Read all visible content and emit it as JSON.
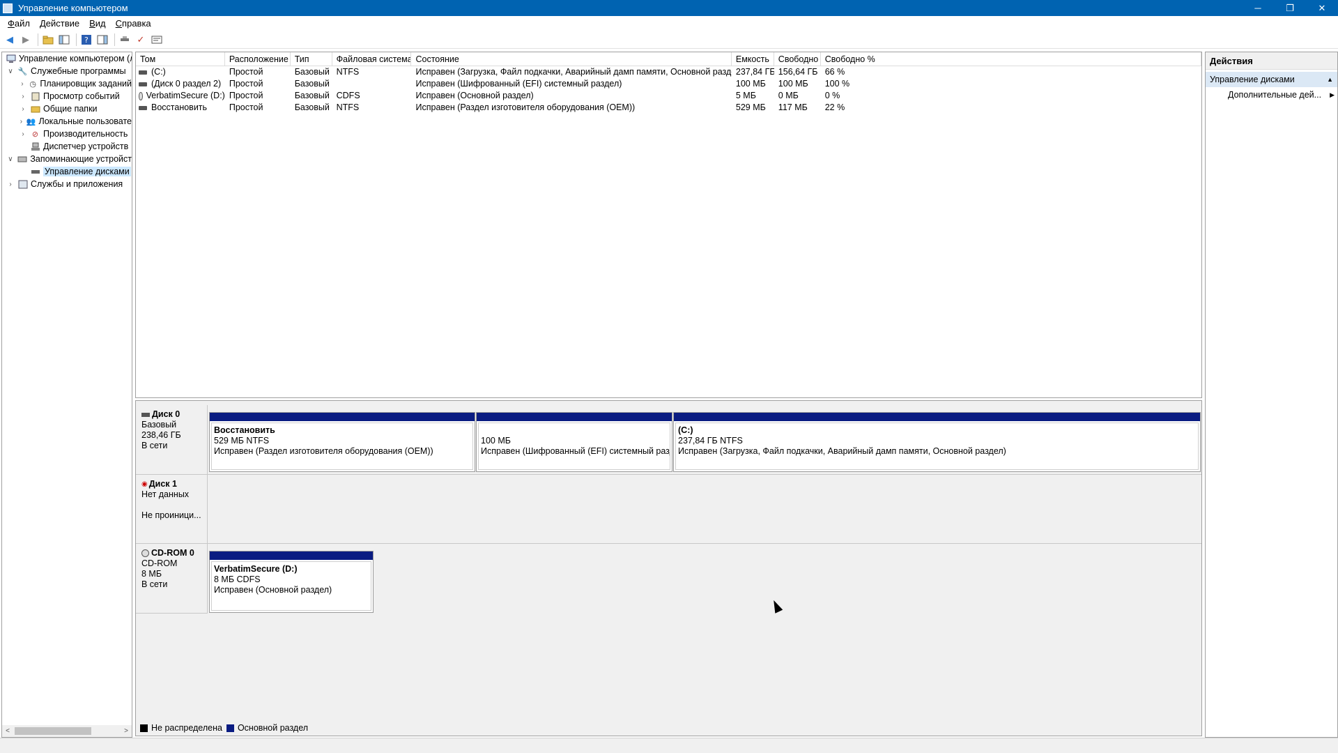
{
  "window": {
    "title": "Управление компьютером",
    "controls": [
      "─",
      "❐",
      "✕"
    ]
  },
  "menu": [
    {
      "accel": "Ф",
      "rest": "айл"
    },
    {
      "accel": "Д",
      "rest": "ействие"
    },
    {
      "accel": "В",
      "rest": "ид"
    },
    {
      "accel": "С",
      "rest": "правка"
    }
  ],
  "tree": {
    "root": "Управление компьютером (л",
    "system_tools": "Служебные программы",
    "task_scheduler": "Планировщик заданий",
    "event_viewer": "Просмотр событий",
    "shared_folders": "Общие папки",
    "local_users": "Локальные пользовате",
    "performance": "Производительность",
    "device_manager": "Диспетчер устройств",
    "storage": "Запоминающие устройст",
    "disk_management": "Управление дисками",
    "services": "Службы и приложения"
  },
  "volumes": {
    "headers": [
      "Том",
      "Расположение",
      "Тип",
      "Файловая система",
      "Состояние",
      "Емкость",
      "Свободно",
      "Свободно %"
    ],
    "rows": [
      [
        "(C:)",
        "Простой",
        "Базовый",
        "NTFS",
        "Исправен (Загрузка, Файл подкачки, Аварийный дамп памяти, Основной раздел)",
        "237,84 ГБ",
        "156,64 ГБ",
        "66 %"
      ],
      [
        "(Диск 0 раздел 2)",
        "Простой",
        "Базовый",
        "",
        "Исправен (Шифрованный (EFI) системный раздел)",
        "100 МБ",
        "100 МБ",
        "100 %"
      ],
      [
        "VerbatimSecure (D:)",
        "Простой",
        "Базовый",
        "CDFS",
        "Исправен (Основной раздел)",
        "5 МБ",
        "0 МБ",
        "0 %"
      ],
      [
        "Восстановить",
        "Простой",
        "Базовый",
        "NTFS",
        "Исправен (Раздел изготовителя оборудования (OEM))",
        "529 МБ",
        "117 МБ",
        "22 %"
      ]
    ]
  },
  "disks": {
    "disk0": {
      "name": "Диск 0",
      "type": "Базовый",
      "size": "238,46 ГБ",
      "status": "В сети",
      "p1": {
        "title": "Восстановить",
        "size": "529 МБ NTFS",
        "status": "Исправен (Раздел изготовителя оборудования (OEM))"
      },
      "p2": {
        "size": "100 МБ",
        "status": "Исправен (Шифрованный (EFI) системный разде"
      },
      "p3": {
        "title": "(C:)",
        "size": "237,84 ГБ NTFS",
        "status": "Исправен (Загрузка, Файл подкачки, Аварийный дамп памяти, Основной раздел)"
      }
    },
    "disk1": {
      "name": "Диск 1",
      "type": "Нет данных",
      "status": "Не проиници..."
    },
    "cdrom0": {
      "name": "CD-ROM 0",
      "type": "CD-ROM",
      "size": "8 МБ",
      "status": "В сети",
      "p1": {
        "title": "VerbatimSecure  (D:)",
        "size": "8 МБ CDFS",
        "status": "Исправен (Основной раздел)"
      }
    }
  },
  "legend": {
    "unallocated": "Не распределена",
    "primary": "Основной раздел",
    "unallocated_color": "#000000",
    "primary_color": "#0a1c82"
  },
  "actions": {
    "header": "Действия",
    "section": "Управление дисками",
    "more": "Дополнительные дей..."
  }
}
